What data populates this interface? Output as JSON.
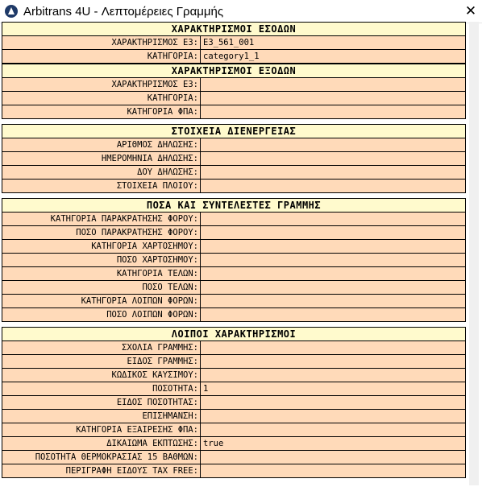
{
  "window": {
    "title": "Arbitrans 4U - Λεπτομέρειες Γραμμής",
    "close_glyph": "✕"
  },
  "colors": {
    "section_bg": "#fffacd",
    "row_bg": "#ffdab9",
    "border": "#000000"
  },
  "sections": {
    "incomes": {
      "header": "ΧΑΡΑΚΤΗΡΙΣΜΟΙ ΕΣΟΔΩΝ",
      "rows": [
        {
          "label": "ΧΑΡΑΚΤΗΡΙΣΜΟΣ Ε3:",
          "value": "E3_561_001"
        },
        {
          "label": "ΚΑΤΗΓΟΡΙΑ:",
          "value": "category1_1"
        }
      ]
    },
    "expenses": {
      "header": "ΧΑΡΑΚΤΗΡΙΣΜΟΙ ΕΞΟΔΩΝ",
      "rows": [
        {
          "label": "ΧΑΡΑΚΤΗΡΙΣΜΟΣ Ε3:",
          "value": ""
        },
        {
          "label": "ΚΑΤΗΓΟΡΙΑ:",
          "value": ""
        },
        {
          "label": "ΚΑΤΗΓΟΡΙΑ ΦΠΑ:",
          "value": ""
        }
      ]
    },
    "shipment": {
      "header": "ΣΤΟΙΧΕΙΑ ΔΙΕΝΕΡΓΕΙΑΣ",
      "rows": [
        {
          "label": "ΑΡΙΘΜΟΣ ΔΗΛΩΣΗΣ:",
          "value": ""
        },
        {
          "label": "ΗΜΕΡΟΜΗΝΙΑ ΔΗΛΩΣΗΣ:",
          "value": ""
        },
        {
          "label": "ΔΟΥ ΔΗΛΩΣΗΣ:",
          "value": ""
        },
        {
          "label": "ΣΤΟΙΧΕΙΑ ΠΛΟΙΟΥ:",
          "value": ""
        }
      ]
    },
    "amounts": {
      "header": "ΠΟΣΑ ΚΑΙ ΣΥΝΤΕΛΕΣΤΕΣ ΓΡΑΜΜΗΣ",
      "rows": [
        {
          "label": "ΚΑΤΗΓΟΡΙΑ ΠΑΡΑΚΡΑΤΗΣΗΣ ΦΟΡΟΥ:",
          "value": ""
        },
        {
          "label": "ΠΟΣΟ ΠΑΡΑΚΡΑΤΗΣΗΣ ΦΟΡΟΥ:",
          "value": ""
        },
        {
          "label": "ΚΑΤΗΓΟΡΙΑ ΧΑΡΤΟΣΗΜΟΥ:",
          "value": ""
        },
        {
          "label": "ΠΟΣΟ ΧΑΡΤΟΣΗΜΟΥ:",
          "value": ""
        },
        {
          "label": "ΚΑΤΗΓΟΡΙΑ ΤΕΛΩΝ:",
          "value": ""
        },
        {
          "label": "ΠΟΣΟ ΤΕΛΩΝ:",
          "value": ""
        },
        {
          "label": "ΚΑΤΗΓΟΡΙΑ ΛΟΙΠΩΝ ΦΟΡΩΝ:",
          "value": ""
        },
        {
          "label": "ΠΟΣΟ ΛΟΙΠΩΝ ΦΟΡΩΝ:",
          "value": ""
        }
      ]
    },
    "other": {
      "header": "ΛΟΙΠΟΙ ΧΑΡΑΚΤΗΡΙΣΜΟΙ",
      "rows": [
        {
          "label": "ΣΧΟΛΙΑ ΓΡΑΜΜΗΣ:",
          "value": ""
        },
        {
          "label": "ΕΙΔΟΣ ΓΡΑΜΜΗΣ:",
          "value": ""
        },
        {
          "label": "ΚΩΔΙΚΟΣ ΚΑΥΣΙΜΟΥ:",
          "value": ""
        },
        {
          "label": "ΠΟΣΟΤΗΤΑ:",
          "value": "1"
        },
        {
          "label": "ΕΙΔΟΣ ΠΟΣΟΤΗΤΑΣ:",
          "value": ""
        },
        {
          "label": "ΕΠΙΣΗΜΑΝΣΗ:",
          "value": ""
        },
        {
          "label": "ΚΑΤΗΓΟΡΙΑ ΕΞΑΙΡΕΣΗΣ ΦΠΑ:",
          "value": ""
        },
        {
          "label": "ΔΙΚΑΙΩΜΑ ΕΚΠΤΩΣΗΣ:",
          "value": "true"
        },
        {
          "label": "ΠΟΣΟΤΗΤΑ ΘΕΡΜΟΚΡΑΣΙΑΣ 15 ΒΑΘΜΩΝ:",
          "value": ""
        },
        {
          "label": "ΠΕΡΙΓΡΑΦΗ ΕΙΔΟΥΣ TAX FREE:",
          "value": ""
        }
      ]
    }
  }
}
